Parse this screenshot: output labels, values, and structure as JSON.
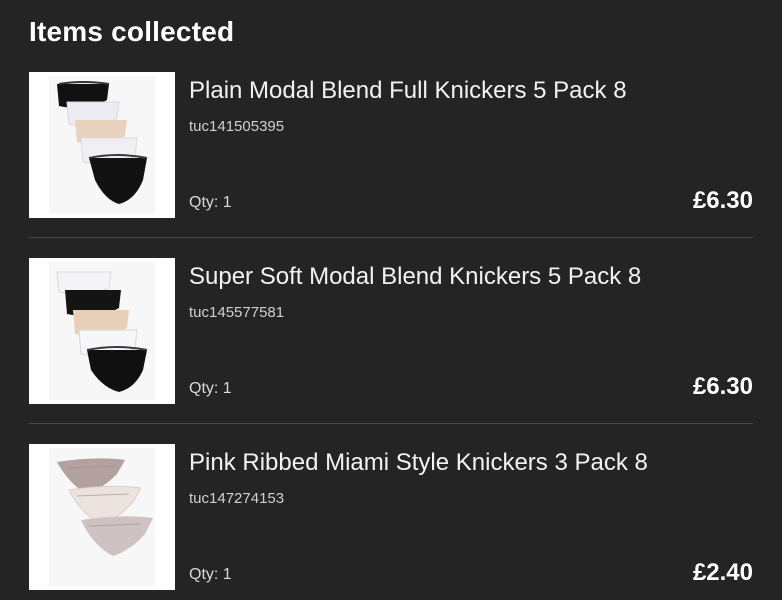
{
  "section": {
    "title": "Items collected"
  },
  "items": [
    {
      "name": "Plain Modal Blend Full Knickers 5 Pack 8",
      "sku": "tuc141505395",
      "qty": "Qty: 1",
      "price": "£6.30"
    },
    {
      "name": "Super Soft Modal Blend Knickers 5 Pack 8",
      "sku": "tuc145577581",
      "qty": "Qty: 1",
      "price": "£6.30"
    },
    {
      "name": "Pink Ribbed Miami Style Knickers 3 Pack 8",
      "sku": "tuc147274153",
      "qty": "Qty: 1",
      "price": "£2.40"
    }
  ],
  "colors": {
    "background": "#242424",
    "text": "#ffffff",
    "divider": "#474747"
  }
}
